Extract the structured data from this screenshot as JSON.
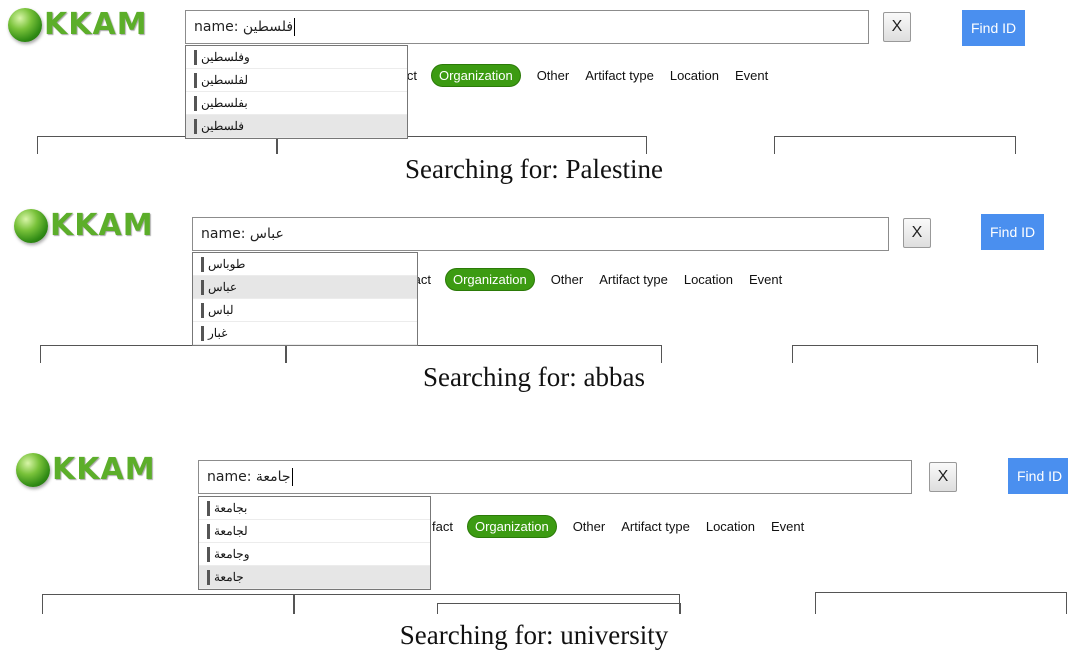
{
  "panels": [
    {
      "logo": "KKAM",
      "search_value": "name: فلسطين",
      "x_label": "X",
      "find_label": "Find ID",
      "tabs": [
        "fact",
        "Organization",
        "Other",
        "Artifact type",
        "Location",
        "Event"
      ],
      "suggestions": [
        "وفلسطين",
        "لفلسطين",
        "بفلسطين",
        "فلسطين"
      ],
      "selected_index": 3,
      "caption": "Searching for: Palestine"
    },
    {
      "logo": "KKAM",
      "search_value": "name: عباس",
      "x_label": "X",
      "find_label": "Find ID",
      "tabs": [
        "fact",
        "Organization",
        "Other",
        "Artifact type",
        "Location",
        "Event"
      ],
      "suggestions": [
        "طوباس",
        "عباس",
        "لباس",
        "غبار"
      ],
      "selected_index": 1,
      "caption": "Searching for: abbas"
    },
    {
      "logo": "KKAM",
      "search_value": "name: جامعة",
      "x_label": "X",
      "find_label": "Find ID",
      "tabs": [
        "fact",
        "Organization",
        "Other",
        "Artifact type",
        "Location",
        "Event"
      ],
      "suggestions": [
        "بجامعة",
        "لجامعة",
        "وجامعة",
        "جامعة"
      ],
      "selected_index": 3,
      "caption": "Searching for: university"
    }
  ],
  "active_tab": "Organization",
  "colors": {
    "accent_green": "#3c9b12",
    "find_button": "#4a8fef",
    "logo_green": "#5cae2a"
  }
}
